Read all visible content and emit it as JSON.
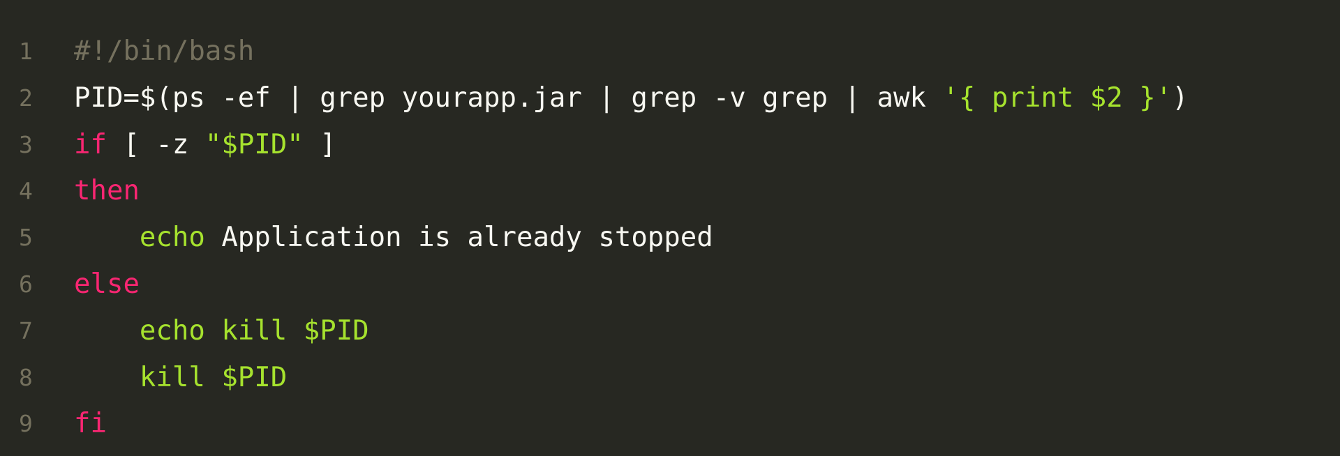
{
  "editor": {
    "lines": [
      {
        "number": "1",
        "tokens": [
          {
            "text": "#!/bin/bash",
            "kind": "comment"
          }
        ]
      },
      {
        "number": "2",
        "tokens": [
          {
            "text": "PID=$(ps -ef | grep yourapp.jar | grep -v grep | awk ",
            "kind": "plain"
          },
          {
            "text": "'{ print $2 }'",
            "kind": "string"
          },
          {
            "text": ")",
            "kind": "plain"
          }
        ]
      },
      {
        "number": "3",
        "tokens": [
          {
            "text": "if",
            "kind": "keyword"
          },
          {
            "text": " [ -z ",
            "kind": "plain"
          },
          {
            "text": "\"$PID\"",
            "kind": "string"
          },
          {
            "text": " ]",
            "kind": "plain"
          }
        ]
      },
      {
        "number": "4",
        "tokens": [
          {
            "text": "then",
            "kind": "keyword"
          }
        ]
      },
      {
        "number": "5",
        "tokens": [
          {
            "text": "    ",
            "kind": "plain"
          },
          {
            "text": "echo",
            "kind": "builtin"
          },
          {
            "text": " Application is already stopped",
            "kind": "plain"
          }
        ]
      },
      {
        "number": "6",
        "tokens": [
          {
            "text": "else",
            "kind": "keyword"
          }
        ]
      },
      {
        "number": "7",
        "tokens": [
          {
            "text": "    ",
            "kind": "plain"
          },
          {
            "text": "echo",
            "kind": "builtin"
          },
          {
            "text": " ",
            "kind": "plain"
          },
          {
            "text": "kill",
            "kind": "builtin"
          },
          {
            "text": " ",
            "kind": "plain"
          },
          {
            "text": "$PID",
            "kind": "var"
          }
        ]
      },
      {
        "number": "8",
        "tokens": [
          {
            "text": "    ",
            "kind": "plain"
          },
          {
            "text": "kill",
            "kind": "builtin"
          },
          {
            "text": " ",
            "kind": "plain"
          },
          {
            "text": "$PID",
            "kind": "var"
          }
        ]
      },
      {
        "number": "9",
        "tokens": [
          {
            "text": "fi",
            "kind": "keyword"
          }
        ]
      }
    ]
  },
  "colors": {
    "background": "#272822",
    "line_number": "#75715e",
    "comment": "#75715e",
    "plain": "#f8f8f2",
    "keyword": "#f92672",
    "builtin": "#a6e22e",
    "string": "#a6e22e"
  }
}
